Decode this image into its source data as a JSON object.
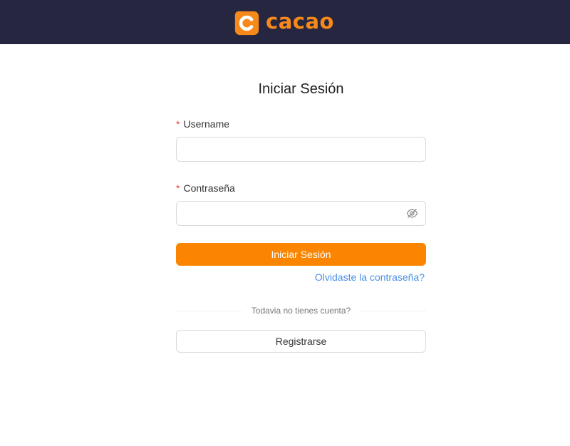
{
  "header": {
    "brand": "cacao",
    "brand_color": "#f7891b",
    "background_color": "#262640"
  },
  "login": {
    "title": "Iniciar Sesión",
    "username": {
      "label": "Username",
      "required_mark": "*",
      "value": ""
    },
    "password": {
      "label": "Contraseña",
      "required_mark": "*",
      "value": "",
      "toggle_icon": "eye-off-icon"
    },
    "submit_label": "Iniciar Sesión",
    "submit_color": "#fb8500",
    "forgot_label": "Olvidaste la contraseña?",
    "divider_text": "Todavia no tienes cuenta?",
    "register_label": "Registrarse"
  }
}
